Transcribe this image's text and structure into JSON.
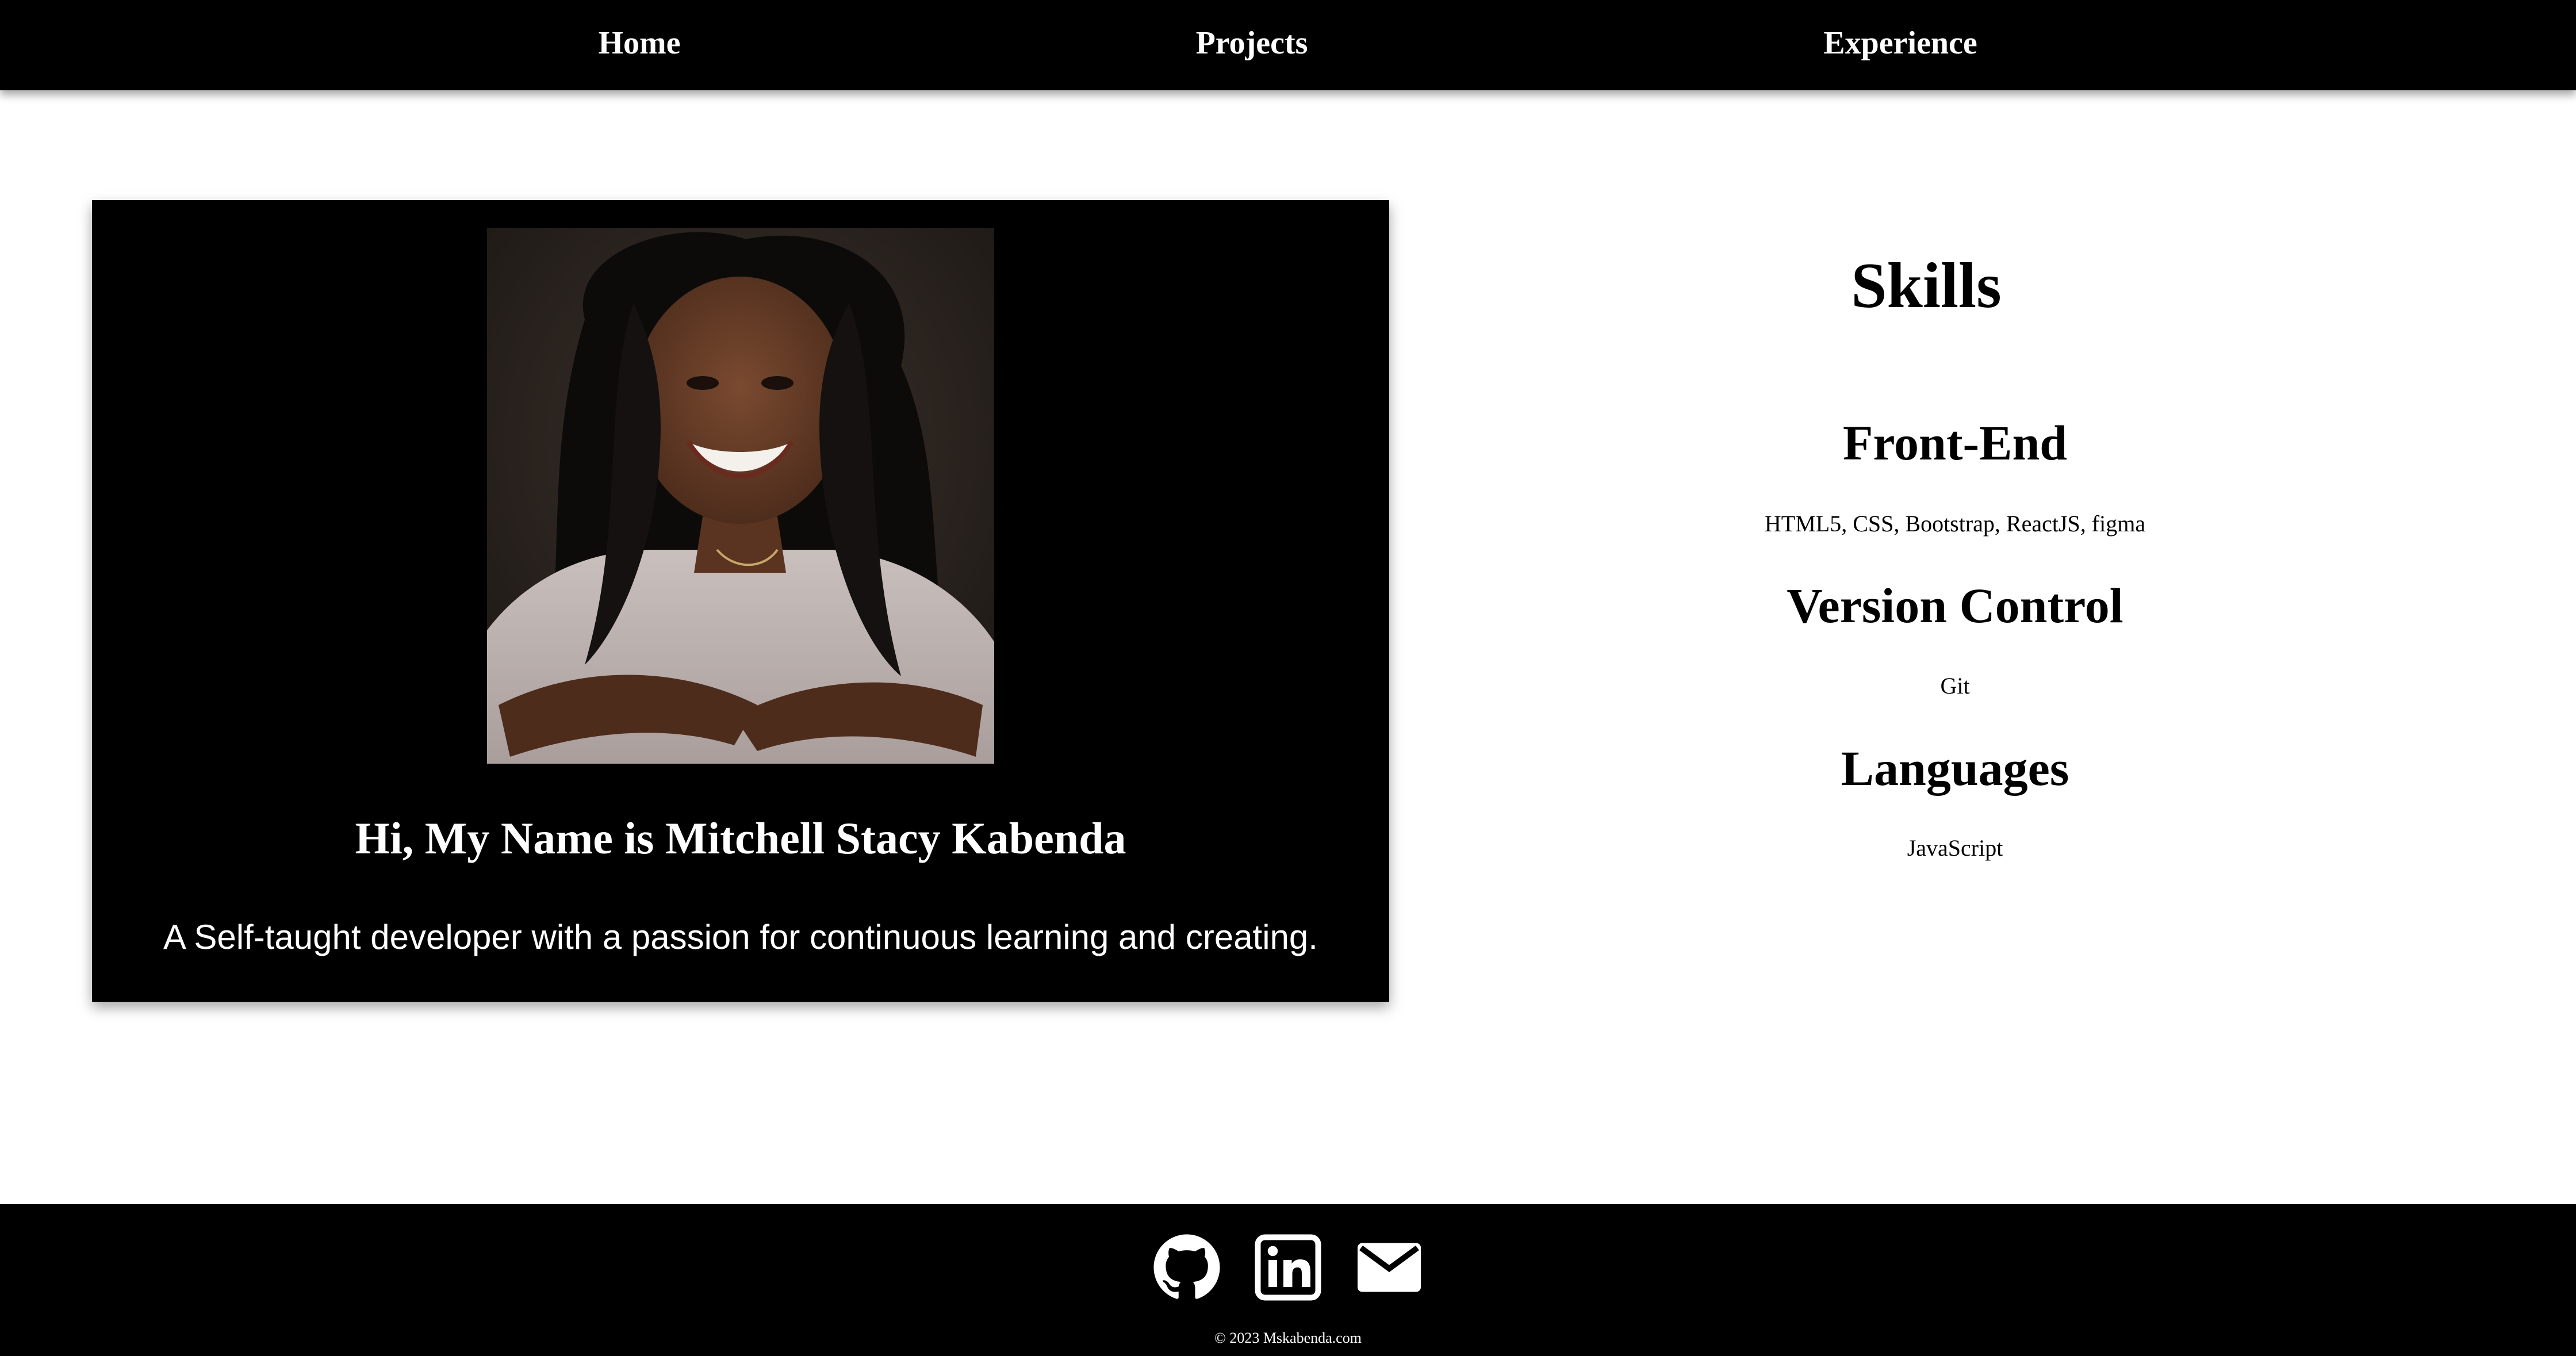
{
  "nav": {
    "items": [
      {
        "label": "Home"
      },
      {
        "label": "Projects"
      },
      {
        "label": "Experience"
      }
    ]
  },
  "hero": {
    "portrait_icon": "portrait-photo",
    "heading": "Hi, My Name is Mitchell Stacy Kabenda",
    "tagline": "A Self-taught developer with a passion for continuous learning and creating."
  },
  "skills": {
    "title": "Skills",
    "groups": [
      {
        "heading": "Front-End",
        "items": "HTML5, CSS, Bootstrap, ReactJS, figma"
      },
      {
        "heading": "Version Control",
        "items": "Git"
      },
      {
        "heading": "Languages",
        "items": "JavaScript"
      }
    ]
  },
  "footer": {
    "icons": [
      "github-icon",
      "linkedin-icon",
      "mail-icon"
    ],
    "copyright": "© 2023 Mskabenda.com"
  },
  "colors": {
    "nav_background": "#000000",
    "card_background": "#000000",
    "footer_background": "#000000",
    "page_background": "#ffffff",
    "light_text": "#ffffff",
    "dark_text": "#000000"
  }
}
